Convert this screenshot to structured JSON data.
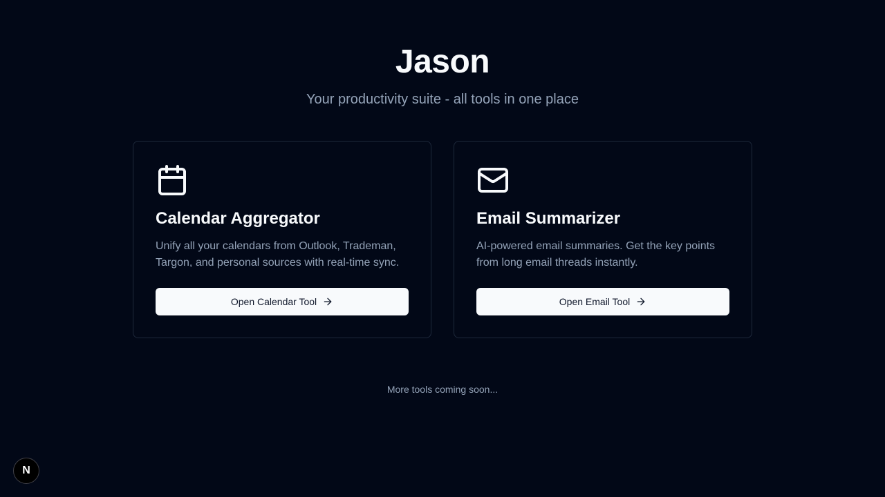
{
  "header": {
    "title": "Jason",
    "subtitle": "Your productivity suite - all tools in one place"
  },
  "cards": [
    {
      "icon": "calendar-icon",
      "title": "Calendar Aggregator",
      "description": "Unify all your calendars from Outlook, Trademan, Targon, and personal sources with real-time sync.",
      "button_label": "Open Calendar Tool"
    },
    {
      "icon": "mail-icon",
      "title": "Email Summarizer",
      "description": "AI-powered email summaries. Get the key points from long email threads instantly.",
      "button_label": "Open Email Tool"
    }
  ],
  "footer": {
    "note": "More tools coming soon..."
  },
  "dev_badge": {
    "label": "N",
    "icon": "nextjs-icon"
  },
  "colors": {
    "background": "#020817",
    "card_border": "#1e293b",
    "text_primary": "#f8fafc",
    "text_muted": "#94a3b8",
    "button_bg": "#f8fafc",
    "button_text": "#0f172a"
  }
}
